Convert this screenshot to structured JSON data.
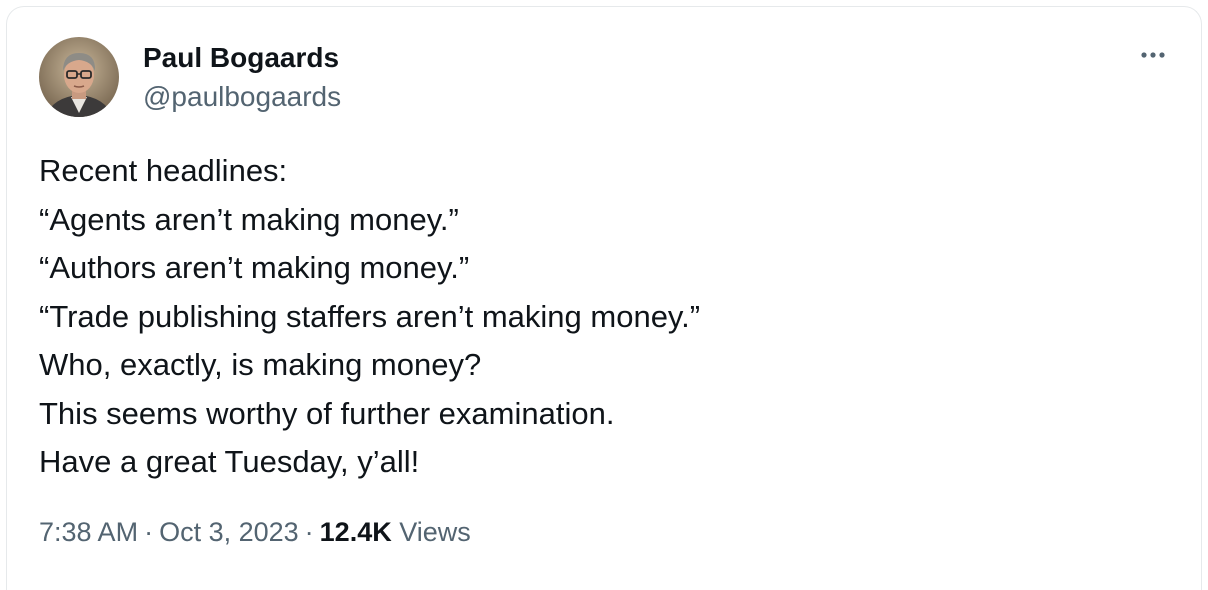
{
  "author": {
    "display_name": "Paul Bogaards",
    "handle": "@paulbogaards",
    "avatar_icon": "profile-photo"
  },
  "menu": {
    "more_icon": "more-horizontal-icon"
  },
  "tweet": {
    "lines": [
      "Recent headlines:",
      "“Agents aren’t making money.”",
      "“Authors aren’t making money.”",
      "“Trade publishing staffers aren’t making money.”",
      "Who, exactly, is making money?",
      "This seems worthy of further examination.",
      "Have a great Tuesday, y’all!"
    ]
  },
  "meta": {
    "time": "7:38 AM",
    "separator": "·",
    "date": "Oct 3, 2023",
    "views_count": "12.4K",
    "views_label": "Views"
  },
  "colors": {
    "text_primary": "#0f1419",
    "text_secondary": "#536471",
    "border": "#e6e9eb"
  }
}
